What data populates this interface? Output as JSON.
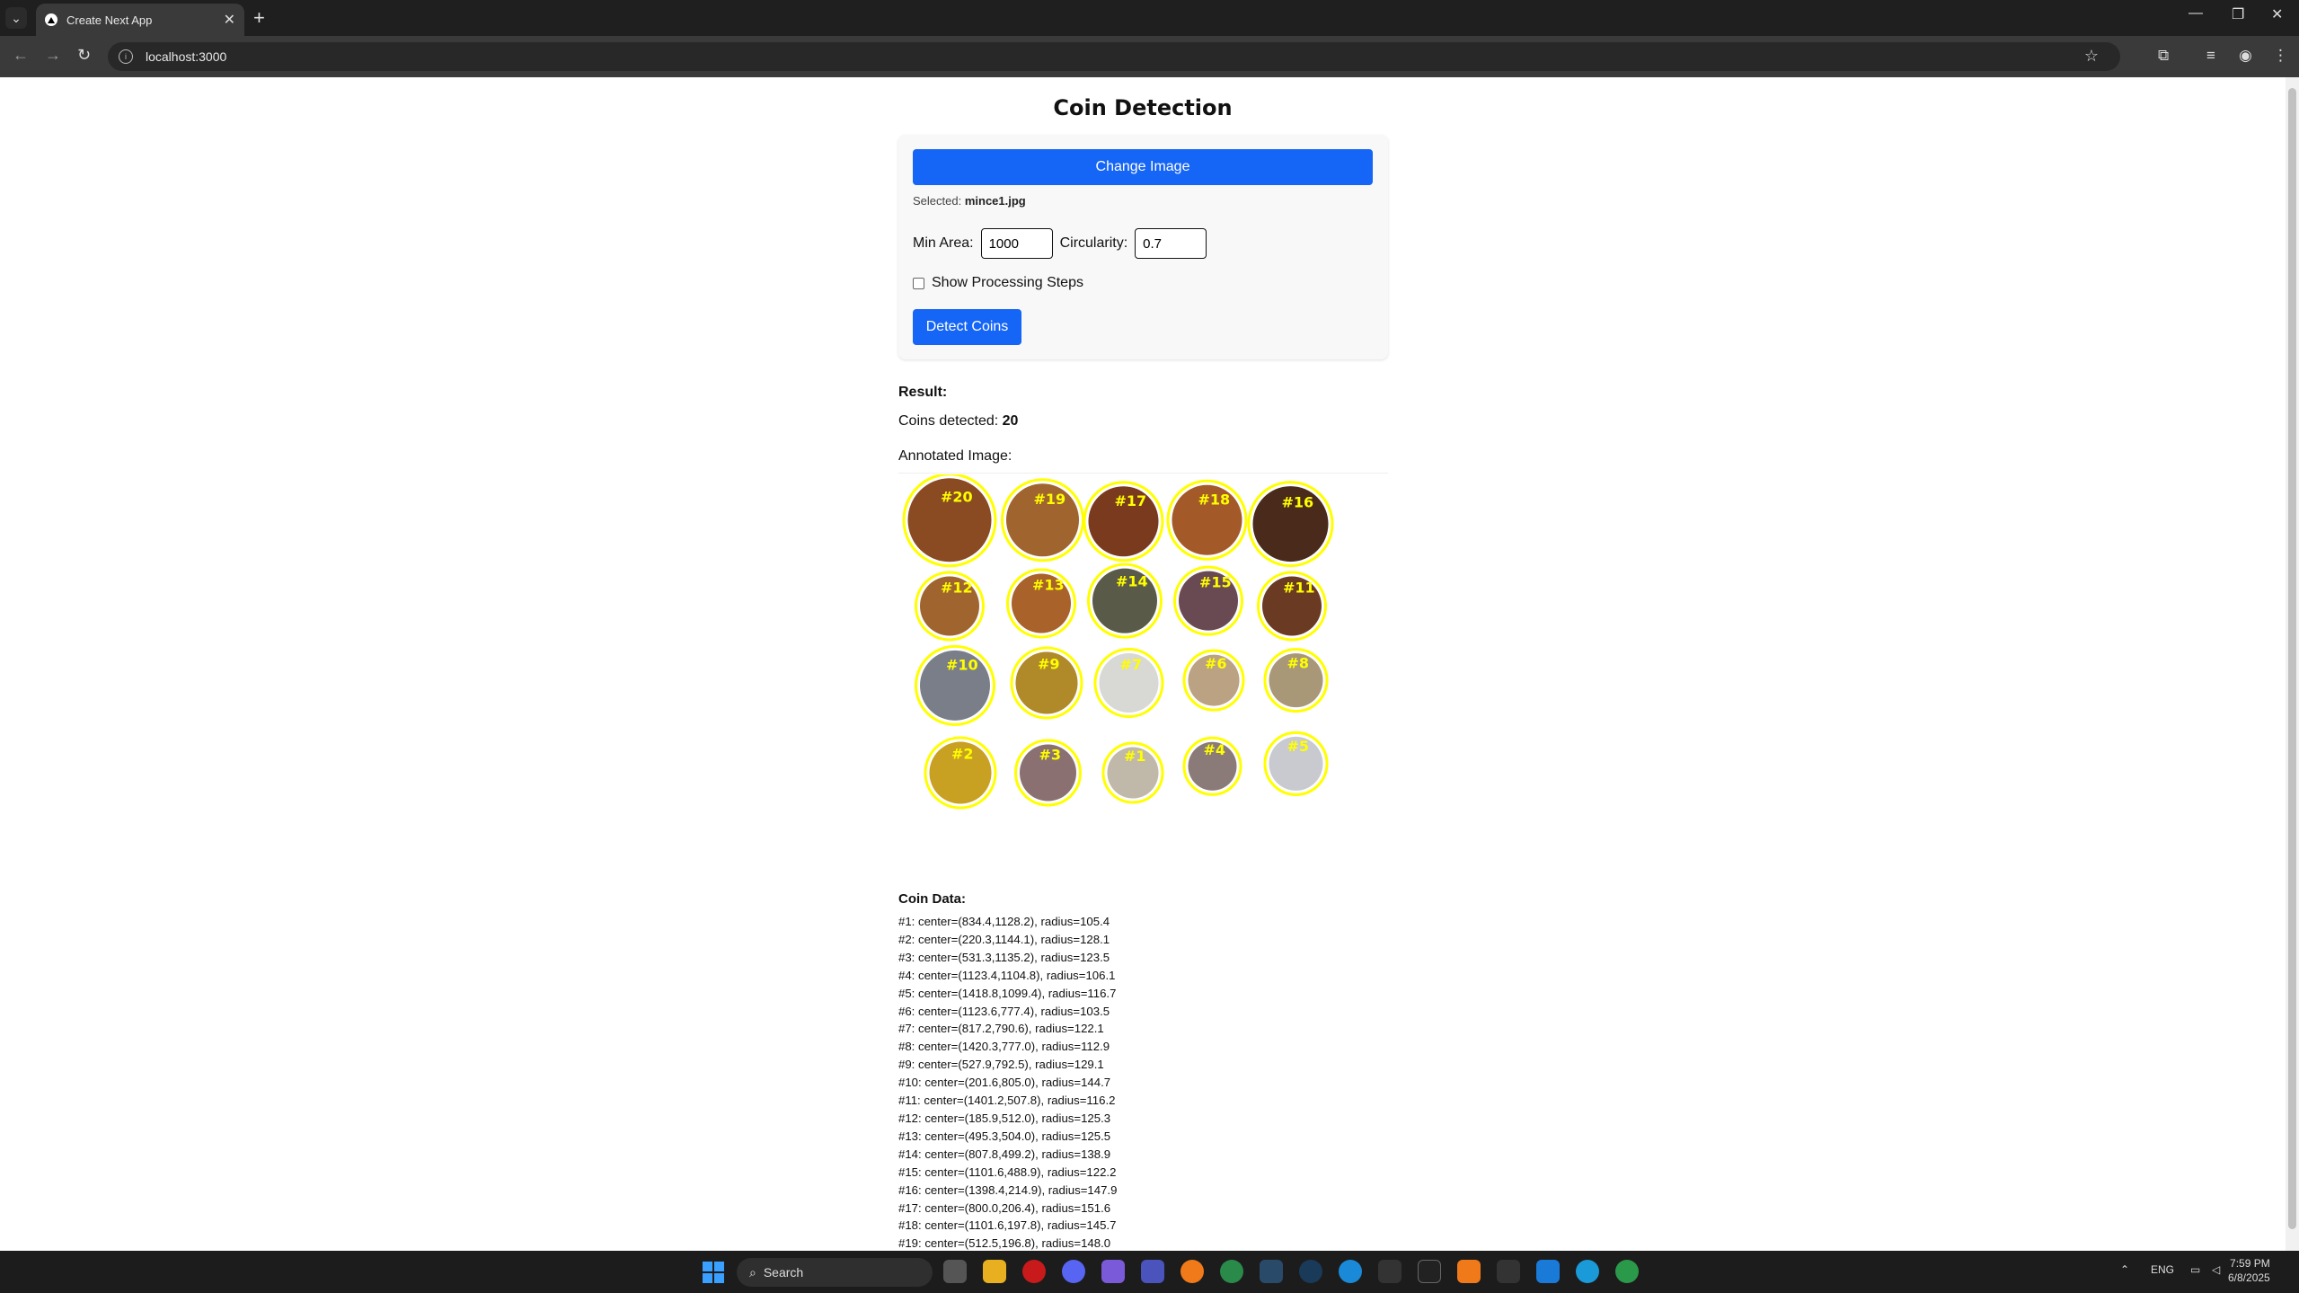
{
  "browser": {
    "tab_title": "Create Next App",
    "url": "localhost:3000"
  },
  "app": {
    "title": "Coin Detection",
    "change_image_label": "Change Image",
    "selected_prefix": "Selected:",
    "selected_file": "mince1.jpg",
    "min_area_label": "Min Area:",
    "min_area_value": "1000",
    "circularity_label": "Circularity:",
    "circularity_value": "0.7",
    "show_steps_label": "Show Processing Steps",
    "show_steps_checked": false,
    "detect_label": "Detect Coins",
    "result_heading": "Result:",
    "coins_detected_label": "Coins detected:",
    "coins_detected_value": "20",
    "annotated_label": "Annotated Image:",
    "coin_data_heading": "Coin Data:",
    "coin_data": [
      "#1: center=(834.4,1128.2), radius=105.4",
      "#2: center=(220.3,1144.1), radius=128.1",
      "#3: center=(531.3,1135.2), radius=123.5",
      "#4: center=(1123.4,1104.8), radius=106.1",
      "#5: center=(1418.8,1099.4), radius=116.7",
      "#6: center=(1123.6,777.4), radius=103.5",
      "#7: center=(817.2,790.6), radius=122.1",
      "#8: center=(1420.3,777.0), radius=112.9",
      "#9: center=(527.9,792.5), radius=129.1",
      "#10: center=(201.6,805.0), radius=144.7",
      "#11: center=(1401.2,507.8), radius=116.2",
      "#12: center=(185.9,512.0), radius=125.3",
      "#13: center=(495.3,504.0), radius=125.5",
      "#14: center=(807.8,499.2), radius=138.9",
      "#15: center=(1101.6,488.9), radius=122.2",
      "#16: center=(1398.4,214.9), radius=147.9",
      "#17: center=(800.0,206.4), radius=151.6",
      "#18: center=(1101.6,197.8), radius=145.7",
      "#19: center=(512.5,196.8), radius=148.0"
    ],
    "coins_visual": [
      {
        "label": "#20",
        "color": "#8a4a22"
      },
      {
        "label": "#19",
        "color": "#a0642e"
      },
      {
        "label": "#17",
        "color": "#7a3a1e"
      },
      {
        "label": "#18",
        "color": "#a45a28"
      },
      {
        "label": "#16",
        "color": "#4a2a1a"
      },
      {
        "label": "#12",
        "color": "#a0642e"
      },
      {
        "label": "#13",
        "color": "#a8622a"
      },
      {
        "label": "#14",
        "color": "#5a5a48"
      },
      {
        "label": "#15",
        "color": "#6a4a52"
      },
      {
        "label": "#11",
        "color": "#6a3a22"
      },
      {
        "label": "#10",
        "color": "#7a7e88"
      },
      {
        "label": "#9",
        "color": "#b08a28"
      },
      {
        "label": "#7",
        "color": "#d8d8d4"
      },
      {
        "label": "#6",
        "color": "#bba282"
      },
      {
        "label": "#8",
        "color": "#a89878"
      },
      {
        "label": "#2",
        "color": "#c8a022"
      },
      {
        "label": "#3",
        "color": "#8a7070"
      },
      {
        "label": "#1",
        "color": "#c0b8a8"
      },
      {
        "label": "#4",
        "color": "#8a7a78"
      },
      {
        "label": "#5",
        "color": "#c8cad0"
      }
    ]
  },
  "taskbar": {
    "search_placeholder": "Search",
    "lang": "ENG",
    "time": "7:59 PM",
    "date": "6/8/2025"
  }
}
